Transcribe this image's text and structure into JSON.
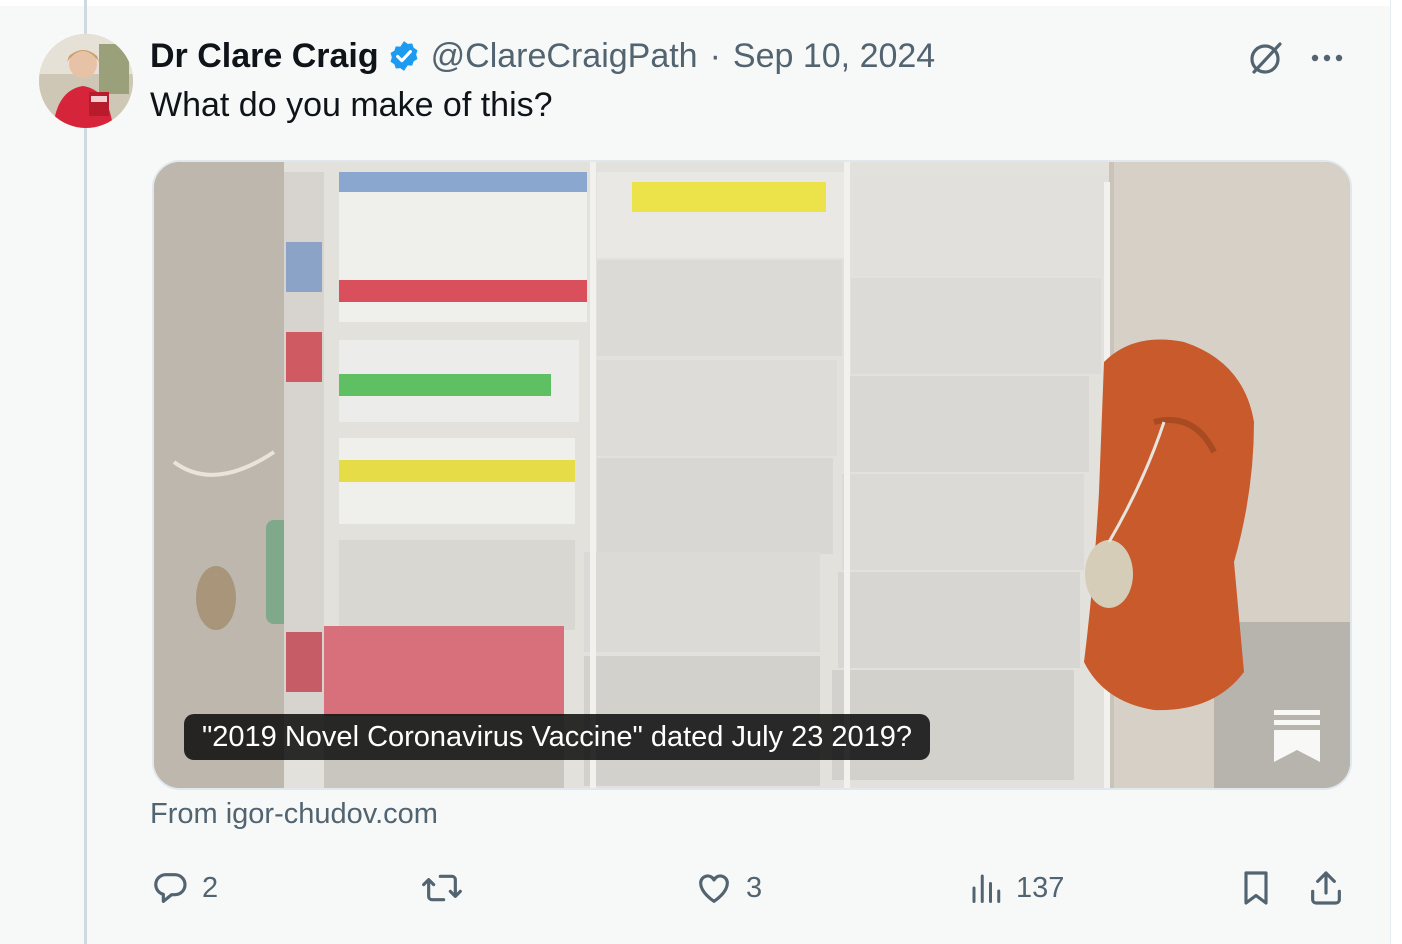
{
  "post": {
    "author_name": "Dr Clare Craig",
    "handle": "@ClareCraigPath",
    "separator": "·",
    "date": "Sep 10, 2024",
    "text": "What do you make of this?",
    "media_caption": "\"2019 Novel Coronavirus Vaccine\" dated July 23 2019?",
    "source": "From igor-chudov.com"
  },
  "actions": {
    "reply_count": "2",
    "repost_count": "",
    "like_count": "3",
    "views_count": "137"
  },
  "icons": {
    "verified": "verified-badge-icon",
    "grok": "grok-icon",
    "more": "more-icon",
    "reply": "reply-icon",
    "repost": "repost-icon",
    "like": "like-icon",
    "views": "views-icon",
    "bookmark": "bookmark-icon",
    "share": "share-icon"
  },
  "colors": {
    "verified_blue": "#1d9bf0",
    "muted_text": "#536471",
    "background": "#f7f9f9"
  }
}
